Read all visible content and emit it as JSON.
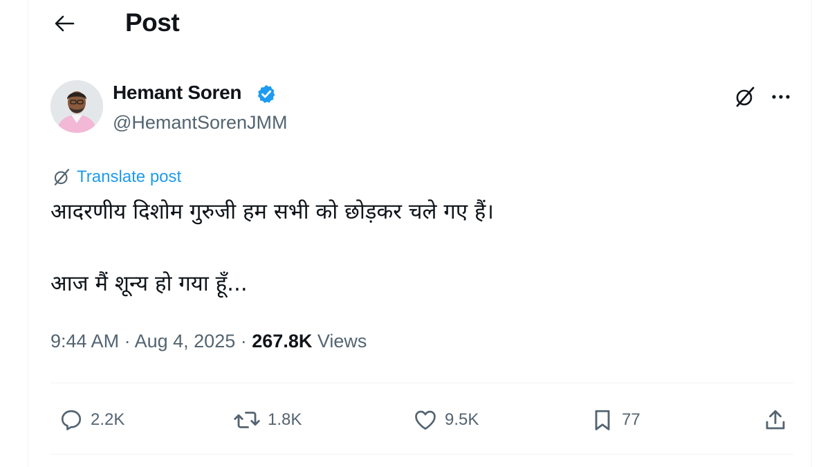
{
  "header": {
    "title": "Post"
  },
  "author": {
    "name": "Hemant Soren",
    "handle": "@HemantSorenJMM"
  },
  "translate_label": "Translate post",
  "post": {
    "text": "आदरणीय दिशोम गुरुजी हम सभी को छोड़कर चले गए हैं।\n\nआज मैं शून्य हो गया हूँ..."
  },
  "meta": {
    "time": "9:44 AM",
    "separator": "·",
    "date": "Aug 4, 2025",
    "views_count": "267.8K",
    "views_label": "Views"
  },
  "actions": {
    "replies": "2.2K",
    "reposts": "1.8K",
    "likes": "9.5K",
    "bookmarks": "77"
  },
  "colors": {
    "accent": "#1d9bf0",
    "text": "#0f1419",
    "secondary": "#536471",
    "border": "#eff3f4"
  },
  "icons": [
    "back-arrow-icon",
    "verified-badge-icon",
    "grok-icon",
    "more-icon",
    "translate-icon",
    "reply-icon",
    "repost-icon",
    "like-icon",
    "bookmark-icon",
    "share-icon"
  ]
}
